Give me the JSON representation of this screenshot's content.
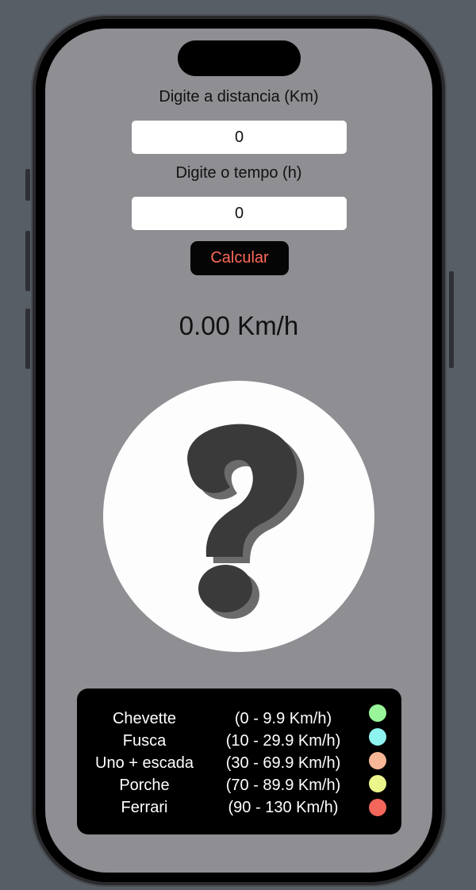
{
  "form": {
    "distance_label": "Digite a distancia (Km)",
    "distance_value": "0",
    "time_label": "Digite o tempo (h)",
    "time_value": "0",
    "calculate_label": "Calcular"
  },
  "result": {
    "speed_text": "0.00 Km/h",
    "image_icon": "question-mark-icon"
  },
  "legend": {
    "items": [
      {
        "car": "Chevette",
        "range": "(0 - 9.9 Km/h)",
        "color": "#98f59a"
      },
      {
        "car": "Fusca",
        "range": "(10 - 29.9 Km/h)",
        "color": "#8ff3ef"
      },
      {
        "car": "Uno + escada",
        "range": "(30 - 69.9 Km/h)",
        "color": "#f7b797"
      },
      {
        "car": "Porche",
        "range": "(70 - 89.9 Km/h)",
        "color": "#eaf58b"
      },
      {
        "car": "Ferrari",
        "range": "(90 - 130 Km/h)",
        "color": "#f2665b"
      }
    ]
  },
  "colors": {
    "screen_bg": "#8e8e93",
    "button_text": "#ff6a5a",
    "legend_bg": "#000000"
  }
}
